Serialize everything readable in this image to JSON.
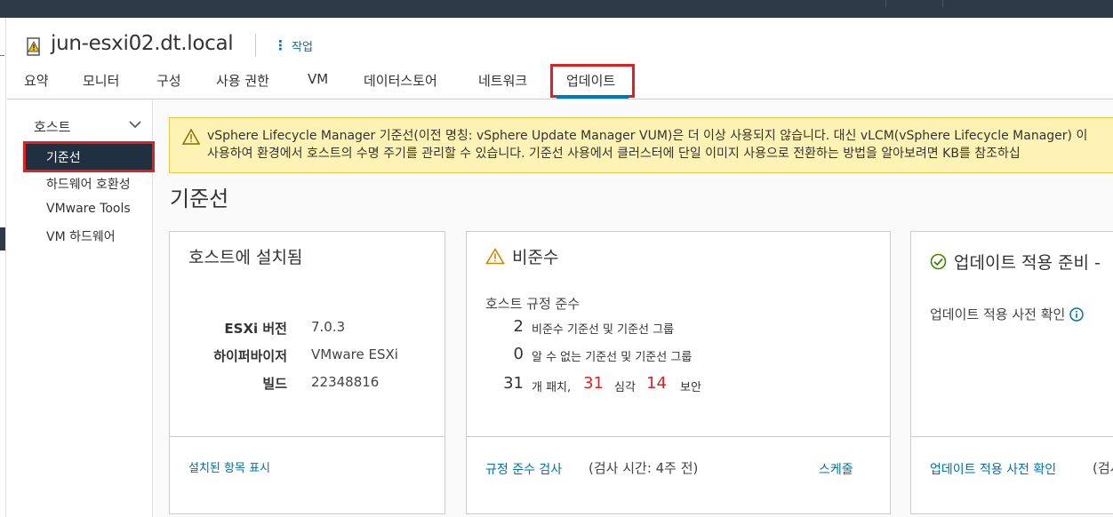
{
  "host": {
    "name": "jun-esxi02.dt.local",
    "actions_label": "작업"
  },
  "tabs": [
    {
      "label": "요약"
    },
    {
      "label": "모니터"
    },
    {
      "label": "구성"
    },
    {
      "label": "사용 권한"
    },
    {
      "label": "VM"
    },
    {
      "label": "데이터스토어"
    },
    {
      "label": "네트워크"
    },
    {
      "label": "업데이트",
      "active": true
    }
  ],
  "sidebar": {
    "section_label": "호스트",
    "items": [
      {
        "label": "기준선",
        "active": true
      },
      {
        "label": "하드웨어 호환성"
      },
      {
        "label": "VMware Tools"
      },
      {
        "label": "VM 하드웨어"
      }
    ]
  },
  "alert": {
    "line1": "vSphere Lifecycle Manager 기준선(이전 명칭: vSphere Update Manager VUM)은 더 이상 사용되지 않습니다. 대신 vLCM(vSphere Lifecycle Manager) 이",
    "line2": "사용하여 환경에서 호스트의 수명 주기를 관리할 수 있습니다. 기준선 사용에서 클러스터에 단일 이미지 사용으로 전환하는 방법을 알아보려면 KB를 참조하십"
  },
  "page_title": "기준선",
  "installed_card": {
    "title": "호스트에 설치됨",
    "fields": [
      {
        "key": "ESXi 버전",
        "value": "7.0.3"
      },
      {
        "key": "하이퍼바이저",
        "value": "VMware ESXi"
      },
      {
        "key": "빌드",
        "value": "22348816"
      }
    ],
    "footer_link": "설치된 항목 표시"
  },
  "compliance_card": {
    "title": "비준수",
    "subtitle": "호스트 규정 준수",
    "rows": [
      {
        "count": "2",
        "text": "비준수 기준선 및 기준선 그룹"
      },
      {
        "count": "0",
        "text": "알 수 없는 기준선 및 기준선 그룹"
      }
    ],
    "patches": {
      "count": "31",
      "patches_label": "개 패치,",
      "critical_count": "31",
      "critical_label": "심각",
      "security_count": "14",
      "security_label": "보안"
    },
    "footer_link": "규정 준수 검사",
    "footer_note": "(검사 시간: 4주 전)",
    "schedule_link": "스케줄"
  },
  "remediation_card": {
    "title": "업데이트 적용 준비 -",
    "precheck_label": "업데이트 적용 사전 확인",
    "footer_link": "업데이트 적용 사전 확인",
    "footer_note": "(검사"
  },
  "colors": {
    "topbar": "#2e3a48",
    "link": "#0072a3",
    "highlight_box": "#e02020",
    "alert_bg": "#fef3b5",
    "active_nav_bg": "#213040"
  }
}
